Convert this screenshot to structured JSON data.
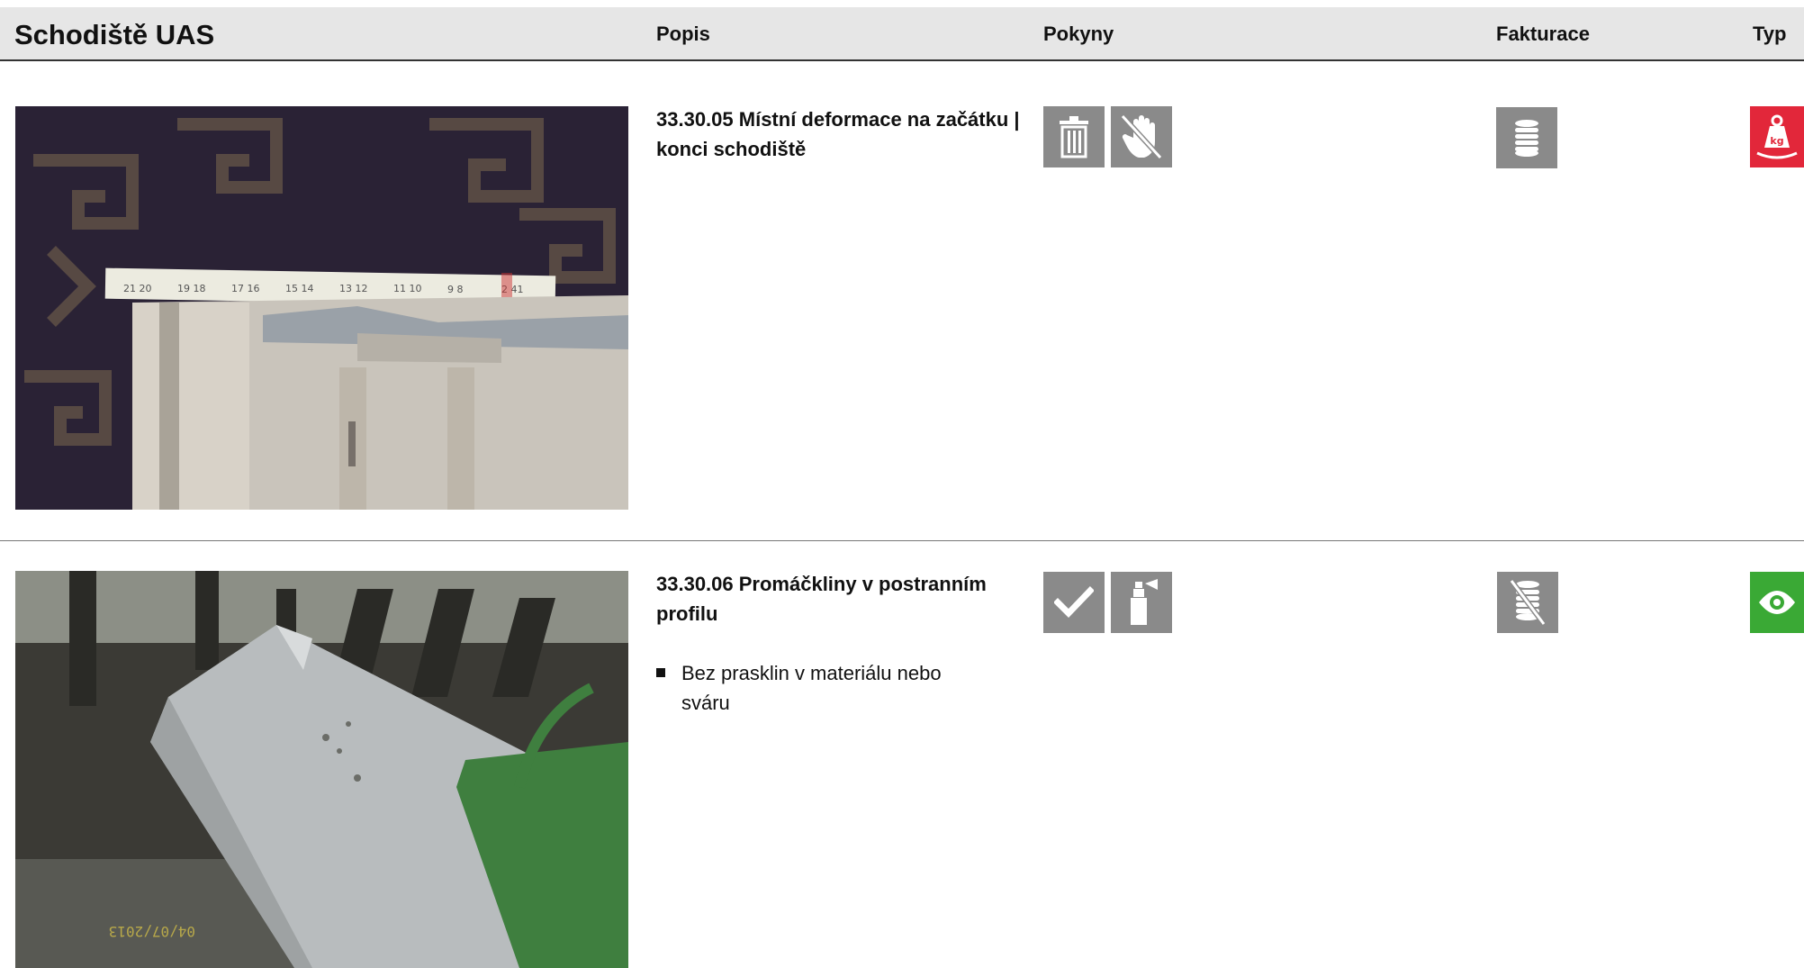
{
  "header": {
    "title": "Schodiště UAS",
    "col_popis": "Popis",
    "col_pokyny": "Pokyny",
    "col_fakturace": "Fakturace",
    "col_typ": "Typ"
  },
  "items": [
    {
      "title": "33.30.05 Místní deformace na začátku | konci schodiště",
      "bullets": [],
      "pokyny_icons": [
        "trash-icon",
        "no-touch-icon"
      ],
      "fakturace_icon": "billing-coins-icon",
      "typ_icon": "weight-kg-icon",
      "typ_label": "kg",
      "typ_color": "#e2273a"
    },
    {
      "title": "33.30.06 Promáčkliny v postranním profilu",
      "bullets": [
        "Bez prasklin v materiálu nebo sváru"
      ],
      "pokyny_icons": [
        "check-icon",
        "spray-icon"
      ],
      "fakturace_icon": "no-billing-icon",
      "typ_icon": "eye-icon",
      "typ_color": "#3aa935"
    }
  ],
  "photo2_timestamp": "04/07/2013",
  "colors": {
    "icon_gray": "#8a8a8a",
    "header_bg": "#e6e6e6"
  }
}
